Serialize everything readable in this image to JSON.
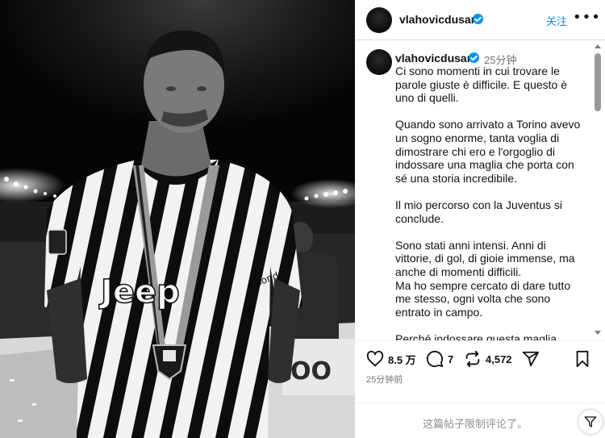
{
  "post": {
    "username": "vlahovicdusan",
    "follow_label": "关注",
    "more_label": "•••",
    "image_alt": "Black-and-white photo of a football player in a striped jersey wearing a medal, looking upward in a stadium"
  },
  "caption": {
    "username": "vlahovicdusan",
    "time": "25分钟",
    "paragraphs": [
      "Ci sono momenti in cui trovare le parole giuste è difficile. E questo è uno di quelli.",
      "Quando sono arrivato a Torino avevo un sogno enorme, tanta voglia di dimostrare chi ero e l'orgoglio di indossare una maglia che porta con sé una storia incredibile.",
      "Il mio percorso con la Juventus si conclude.",
      "Sono stati anni intensi. Anni di vittorie, di gol, di gioie immense, ma anche di momenti difficili.\nMa ho sempre cercato di dare tutto me stesso, ogni volta che sono entrato in campo.",
      "Perché indossare questa maglia"
    ]
  },
  "actions": {
    "likes": "8.5 万",
    "comments": "7",
    "reposts": "4,572",
    "post_time": "25分钟前"
  },
  "footer": {
    "limit_text": "这篇帖子限制评论了。"
  },
  "colors": {
    "accent": "#0095f6",
    "muted": "#737373"
  },
  "icons": [
    "verified-badge-icon",
    "more-icon",
    "heart-icon",
    "comment-icon",
    "repost-icon",
    "share-icon",
    "bookmark-icon",
    "filter-icon"
  ]
}
